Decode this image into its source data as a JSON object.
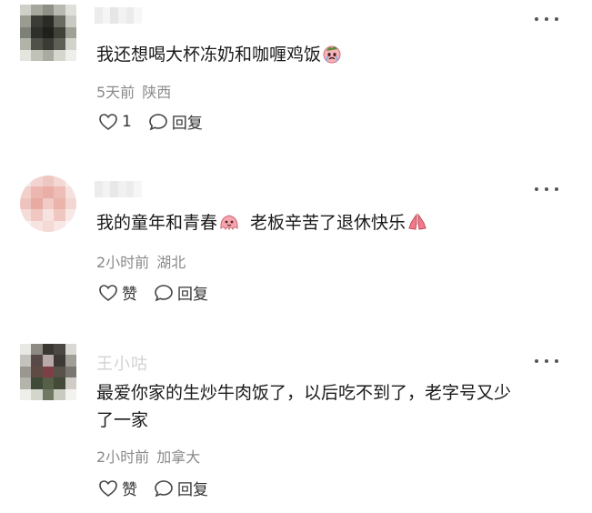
{
  "comments": [
    {
      "text": "我还想喝大杯冻奶和咖喱鸡饭",
      "time": "5天前",
      "location": "陕西",
      "like_label": "1",
      "reply_label": "回复"
    },
    {
      "text_part1": "我的童年和青春",
      "text_part2": "老板辛苦了退休快乐",
      "time": "2小时前",
      "location": "湖北",
      "like_label": "赞",
      "reply_label": "回复"
    },
    {
      "username": "王小咕",
      "text_line1": "最爱你家的生炒牛肉饭了，以后吃不到了，老字号又少",
      "text_line2": "了一家",
      "time": "2小时前",
      "location": "加拿大",
      "like_label": "赞",
      "reply_label": "回复"
    }
  ],
  "icons": {
    "more": "more-dots-icon",
    "like": "heart-outline-icon",
    "reply": "speech-bubble-icon",
    "emoji_crying": "crying-face-emoji",
    "emoji_octopus": "pink-blob-emoji",
    "emoji_hands": "praying-hands-emoji"
  },
  "colors": {
    "text": "#1a1a1a",
    "meta": "#8a8a8a",
    "action": "#333333"
  }
}
